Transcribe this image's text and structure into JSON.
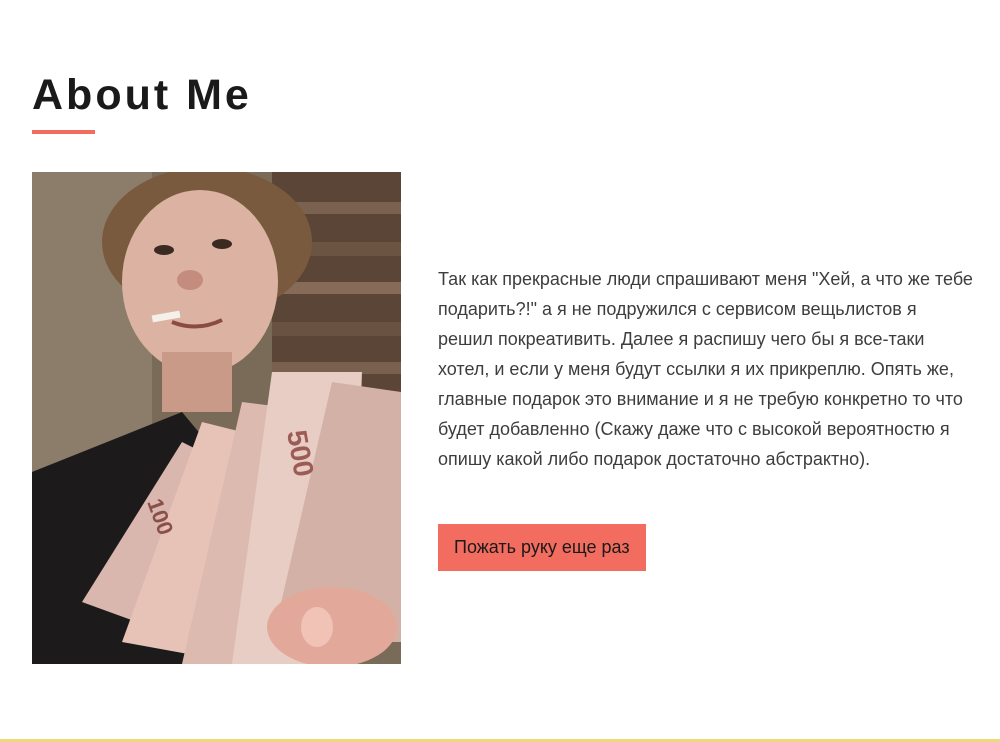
{
  "about": {
    "title": "About Me",
    "photo_icon": "person-photo",
    "paragraph": "Так как прекрасные люди спрашивают меня \"Хей, а что же тебе подарить?!\" а я не подружился с сервисом вещьлистов я решил покреативить. Далее я распишу чего бы я все-таки хотел, и если у меня будут ссылки я их прикреплю. Опять же, главные подарок это внимание и я не требую конкретно то что будет добавленно (Скажу даже что с высокой вероятностю я опишу какой либо подарок достаточно абстрактно).",
    "button_label": "Пожать руку еще раз"
  },
  "colors": {
    "accent": "#f26c5f",
    "border": "#ecd97a",
    "text": "#3d3d3d",
    "title": "#1a1a1a"
  }
}
